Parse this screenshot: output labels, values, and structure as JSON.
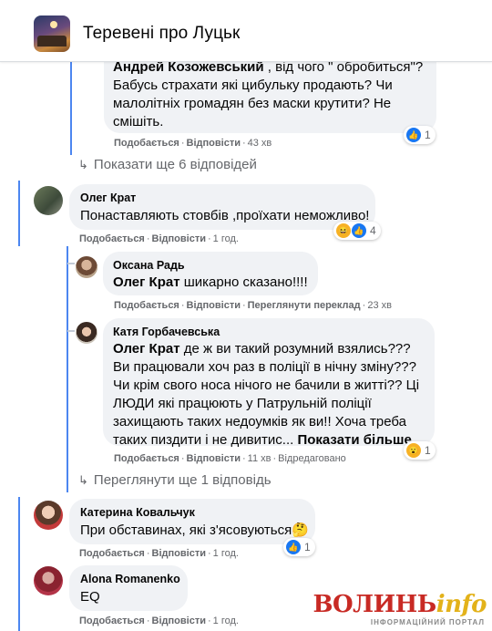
{
  "header": {
    "group_title": "Теревені про Луцьк"
  },
  "actions": {
    "like": "Подобається",
    "reply": "Відповісти",
    "see_translation": "Переглянути переклад",
    "edited": "Відредаговано",
    "see_more": "Показати більше..."
  },
  "comments": [
    {
      "author": "Андрей Козожевський",
      "text": ", від чого \" обробиться\"? Бабусь страхати які цибульку продають? Чи малолітніх громадян без маски крутити? Не смішіть.",
      "time": "43 хв",
      "reaction_count": "1",
      "reactions": [
        "like-icon"
      ]
    },
    {
      "show_more_replies": "Показати ще 6 відповідей"
    },
    {
      "author": "Олег Крат",
      "text": "Понаставляють стовбів ,проїхати неможливо!",
      "time": "1 год.",
      "reaction_count": "4",
      "reactions": [
        "haha-icon",
        "like-icon"
      ]
    },
    {
      "author": "Оксана Радь",
      "mention": "Олег Крат",
      "text": "шикарно сказано!!!!",
      "time": "23 хв"
    },
    {
      "author": "Катя Горбачевська",
      "mention": "Олег Крат",
      "text": "де ж ви такий розумний взялись??? Ви працювали хоч раз в поліції в нічну зміну??? Чи крім свого носа нічого не бачили в житті?? Ці ЛЮДИ які працюють у Патрульній поліції захищають таких недоумків як ви!! Хоча треба таких пиздити і не дивитис...",
      "time": "11 хв",
      "reaction_count": "1",
      "reactions": [
        "wow-icon"
      ]
    },
    {
      "show_more_replies": "Переглянути ще 1 відповідь"
    },
    {
      "author": "Катерина Ковальчук",
      "text": "При обставинах, які з'ясовуються🤔",
      "time": "1 год.",
      "reaction_count": "1",
      "reactions": [
        "like-icon"
      ]
    },
    {
      "author": "Alona Romanenko",
      "text": "EQ",
      "time": "1 год."
    }
  ],
  "watermark": {
    "main": "ВОЛИНЬ",
    "accent": "info",
    "sub": "ІНФОРМАЦІЙНИЙ ПОРТАЛ"
  },
  "colors": {
    "link_blue": "#1877f2",
    "thread_line": "#4c86f0",
    "bubble_bg": "#f0f2f5",
    "meta_grey": "#65676b"
  }
}
